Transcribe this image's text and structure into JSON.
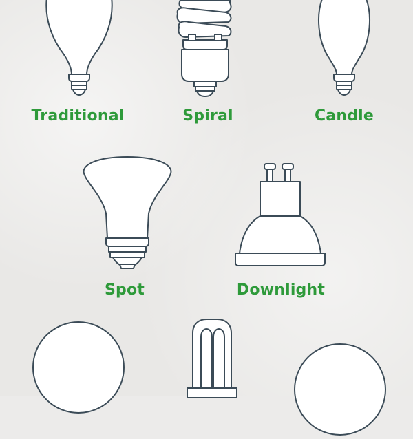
{
  "colors": {
    "label": "#2e9a3a",
    "outline": "#3b4b57",
    "background": "#e9e8e6"
  },
  "bulbs": [
    {
      "label": "Traditional",
      "icon": "traditional-bulb-icon"
    },
    {
      "label": "Spiral",
      "icon": "spiral-bulb-icon"
    },
    {
      "label": "Candle",
      "icon": "candle-bulb-icon"
    },
    {
      "label": "Spot",
      "icon": "spot-bulb-icon"
    },
    {
      "label": "Downlight",
      "icon": "downlight-bulb-icon"
    },
    {
      "label": "",
      "icon": "globe-bulb-icon"
    },
    {
      "label": "",
      "icon": "stick-bulb-icon"
    },
    {
      "label": "",
      "icon": "round-bulb-icon"
    }
  ]
}
